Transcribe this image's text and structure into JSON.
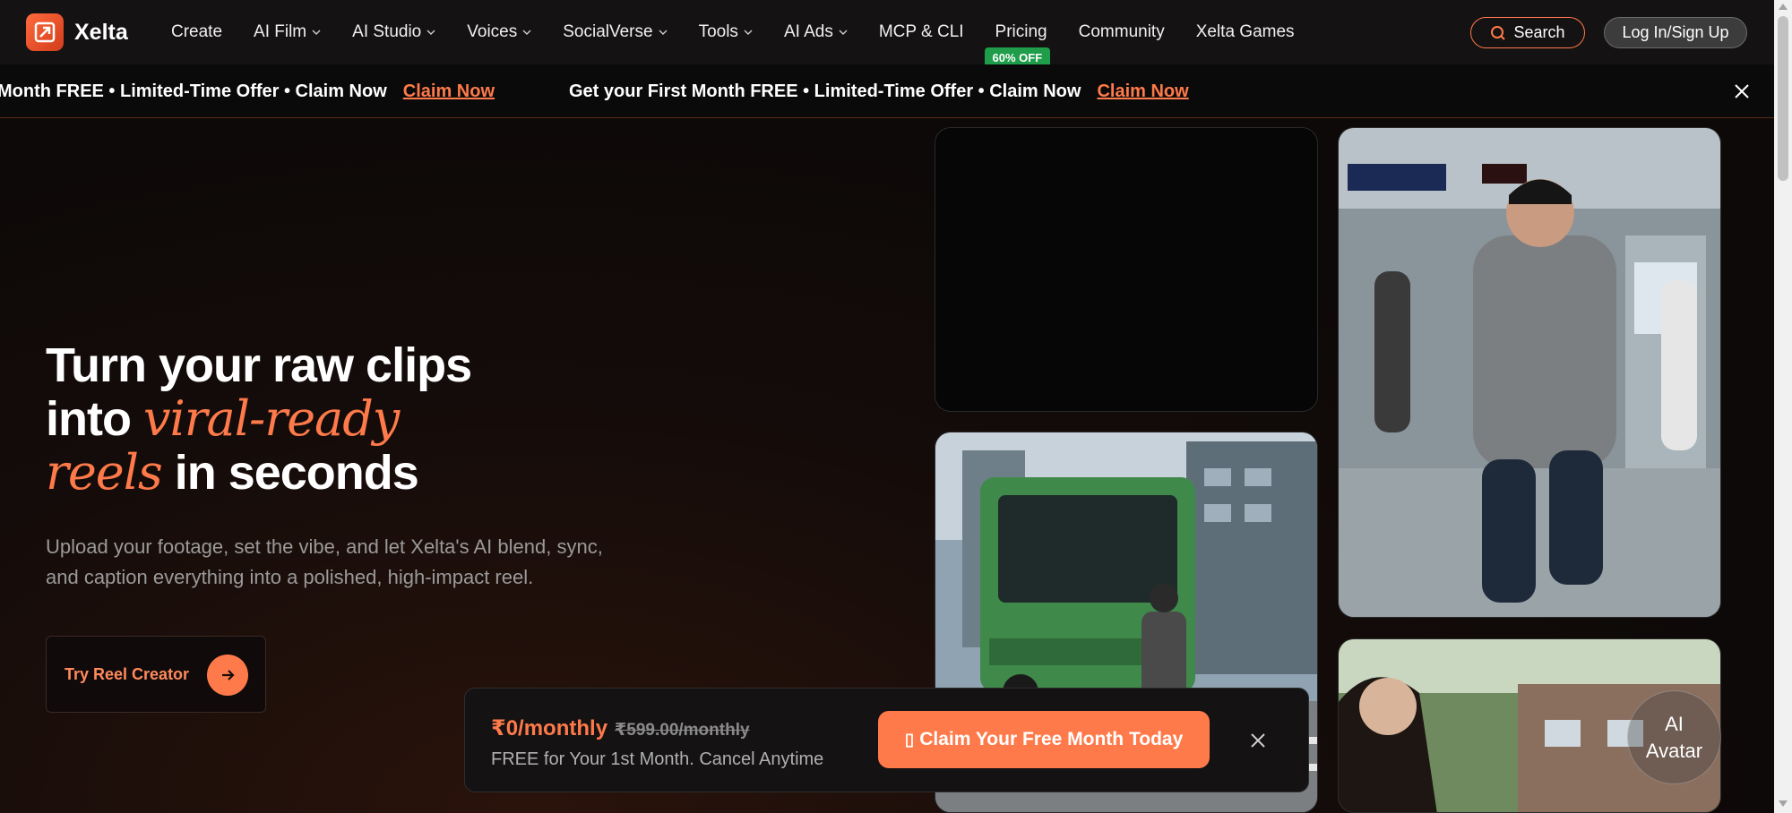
{
  "brand": {
    "name": "Xelta"
  },
  "nav": {
    "items": [
      {
        "label": "Create",
        "has_dropdown": false
      },
      {
        "label": "AI Film",
        "has_dropdown": true
      },
      {
        "label": "AI Studio",
        "has_dropdown": true
      },
      {
        "label": "Voices",
        "has_dropdown": true
      },
      {
        "label": "SocialVerse",
        "has_dropdown": true
      },
      {
        "label": "Tools",
        "has_dropdown": true
      },
      {
        "label": "AI Ads",
        "has_dropdown": true
      },
      {
        "label": "MCP & CLI",
        "has_dropdown": false
      },
      {
        "label": "Pricing",
        "has_dropdown": false,
        "badge": "60% OFF"
      },
      {
        "label": "Community",
        "has_dropdown": false
      },
      {
        "label": "Xelta Games",
        "has_dropdown": false
      }
    ],
    "search_label": "Search",
    "login_label": "Log In/Sign Up"
  },
  "banner": {
    "text_partial": "Month FREE • Limited-Time Offer • Claim Now",
    "text": "Get your First Month FREE • Limited-Time Offer • Claim Now",
    "link": "Claim Now"
  },
  "hero": {
    "title_line1": "Turn your raw clips",
    "title_line2_plain": "into ",
    "title_line2_accent": "viral-ready",
    "title_line3_accent": "reels",
    "title_line3_plain": " in seconds",
    "subtitle": "Upload your footage, set the vibe, and let Xelta's AI blend, sync, and caption everything into a polished, high-impact reel.",
    "cta_label": "Try Reel Creator"
  },
  "gallery": {
    "ai_avatar_label": "AI Avatar"
  },
  "promo": {
    "price_now": "₹0/monthly",
    "price_old": "₹599.00/monthly",
    "note": "FREE for Your 1st Month. Cancel Anytime",
    "button_label": "Claim Your Free Month Today"
  },
  "colors": {
    "accent": "#ff7a4a",
    "badge_green": "#1f9d4a",
    "nav_bg": "#141212"
  }
}
